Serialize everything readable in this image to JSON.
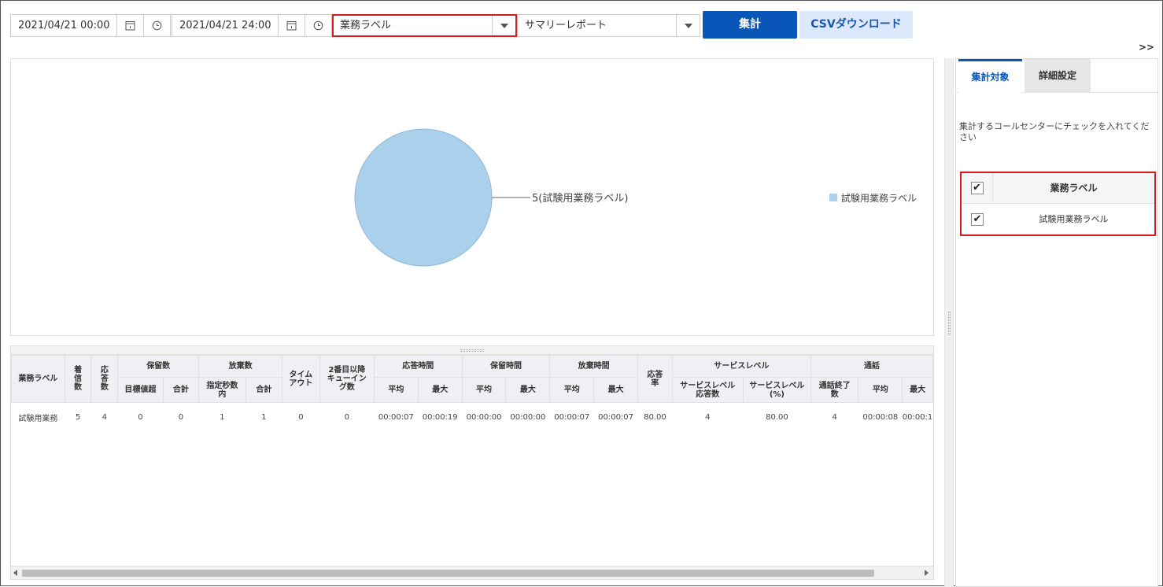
{
  "toolbar": {
    "start_datetime": "2021/04/21 00:00",
    "end_datetime": "2021/04/21 24:00",
    "group_select": "業務ラベル",
    "report_select": "サマリーレポート",
    "aggregate_label": "集計",
    "csv_label": "CSVダウンロード",
    "expand_label": ">>"
  },
  "chart_data": {
    "type": "pie",
    "categories": [
      "試験用業務ラベル"
    ],
    "values": [
      5
    ],
    "slice_labels": [
      "5(試験用業務ラベル)"
    ],
    "legend": [
      "試験用業務ラベル"
    ],
    "legend_position": "right",
    "colors": [
      "#abd0eb"
    ]
  },
  "table": {
    "headers": {
      "label": "業務ラベル",
      "incoming": "着\n信\n数",
      "answered": "応\n答\n数",
      "hold": "保留数",
      "hold_target": "目標値超",
      "hold_total": "合計",
      "abandon": "放棄数",
      "abandon_within": "指定秒数\n内",
      "abandon_total": "合計",
      "timeout": "タイム\nアウト",
      "queuing": "2番目以降\nキューイン\nグ数",
      "answer_time": "応答時間",
      "answer_avg": "平均",
      "answer_max": "最大",
      "hold_time": "保留時間",
      "hold_avg": "平均",
      "hold_max": "最大",
      "abandon_time": "放棄時間",
      "abandon_avg": "平均",
      "abandon_max": "最大",
      "answer_rate": "応答\n率",
      "service_level": "サービスレベル",
      "sl_count": "サービスレベル\n応答数",
      "sl_pct": "サービスレベル\n(%)",
      "call": "通話",
      "call_ended": "通話終了\n数",
      "call_avg": "平均",
      "call_max": "最大"
    },
    "rows": [
      [
        "試験用業務",
        "5",
        "4",
        "0",
        "0",
        "1",
        "1",
        "0",
        "0",
        "00:00:07",
        "00:00:19",
        "00:00:00",
        "00:00:00",
        "00:00:07",
        "00:00:07",
        "80.00",
        "4",
        "80.00",
        "4",
        "00:00:08",
        "00:00:1"
      ]
    ]
  },
  "side": {
    "tab_target": "集計対象",
    "tab_detail": "詳細設定",
    "hint": "集計するコールセンターにチェックを入れてください",
    "header_label": "業務ラベル",
    "item_label": "試験用業務ラベル",
    "checkmark": "✔"
  }
}
